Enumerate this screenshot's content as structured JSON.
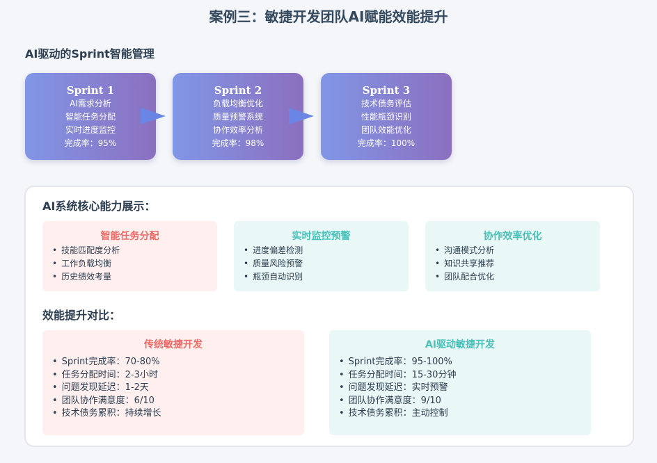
{
  "page_title": "案例三：敏捷开发团队AI赋能效能提升",
  "sprint_section": {
    "title": "AI驱动的Sprint智能管理",
    "sprints": [
      {
        "name": "Sprint 1",
        "lines": [
          "AI需求分析",
          "智能任务分配",
          "实时进度监控",
          "完成率：95%"
        ]
      },
      {
        "name": "Sprint 2",
        "lines": [
          "负载均衡优化",
          "质量预警系统",
          "协作效率分析",
          "完成率：98%"
        ]
      },
      {
        "name": "Sprint 3",
        "lines": [
          "技术债务评估",
          "性能瓶颈识别",
          "团队效能优化",
          "完成率：100%"
        ]
      }
    ],
    "colors": {
      "gradient_start": "#8196e6",
      "gradient_end": "#8c6fbf",
      "arrow": "#6a85e3"
    }
  },
  "capabilities": {
    "title": "AI系统核心能力展示：",
    "cards": [
      {
        "title": "智能任务分配",
        "items": [
          "技能匹配度分析",
          "工作负载均衡",
          "历史绩效考量"
        ]
      },
      {
        "title": "实时监控预警",
        "items": [
          "进度偏差检测",
          "质量风险预警",
          "瓶颈自动识别"
        ]
      },
      {
        "title": "协作效率优化",
        "items": [
          "沟通模式分析",
          "知识共享推荐",
          "团队配合优化"
        ]
      }
    ]
  },
  "comparison": {
    "title": "效能提升对比：",
    "traditional": {
      "title": "传统敏捷开发",
      "items": [
        "Sprint完成率：70-80%",
        "任务分配时间：2-3小时",
        "问题发现延迟：1-2天",
        "团队协作满意度：6/10",
        "技术债务累积：持续增长"
      ]
    },
    "ai": {
      "title": "AI驱动敏捷开发",
      "items": [
        "Sprint完成率：95-100%",
        "任务分配时间：15-30分钟",
        "问题发现延迟：实时预警",
        "团队协作满意度：9/10",
        "技术债务累积：主动控制"
      ]
    },
    "colors": {
      "traditional_accent": "#ee6a66",
      "ai_accent": "#48c1b9"
    }
  }
}
